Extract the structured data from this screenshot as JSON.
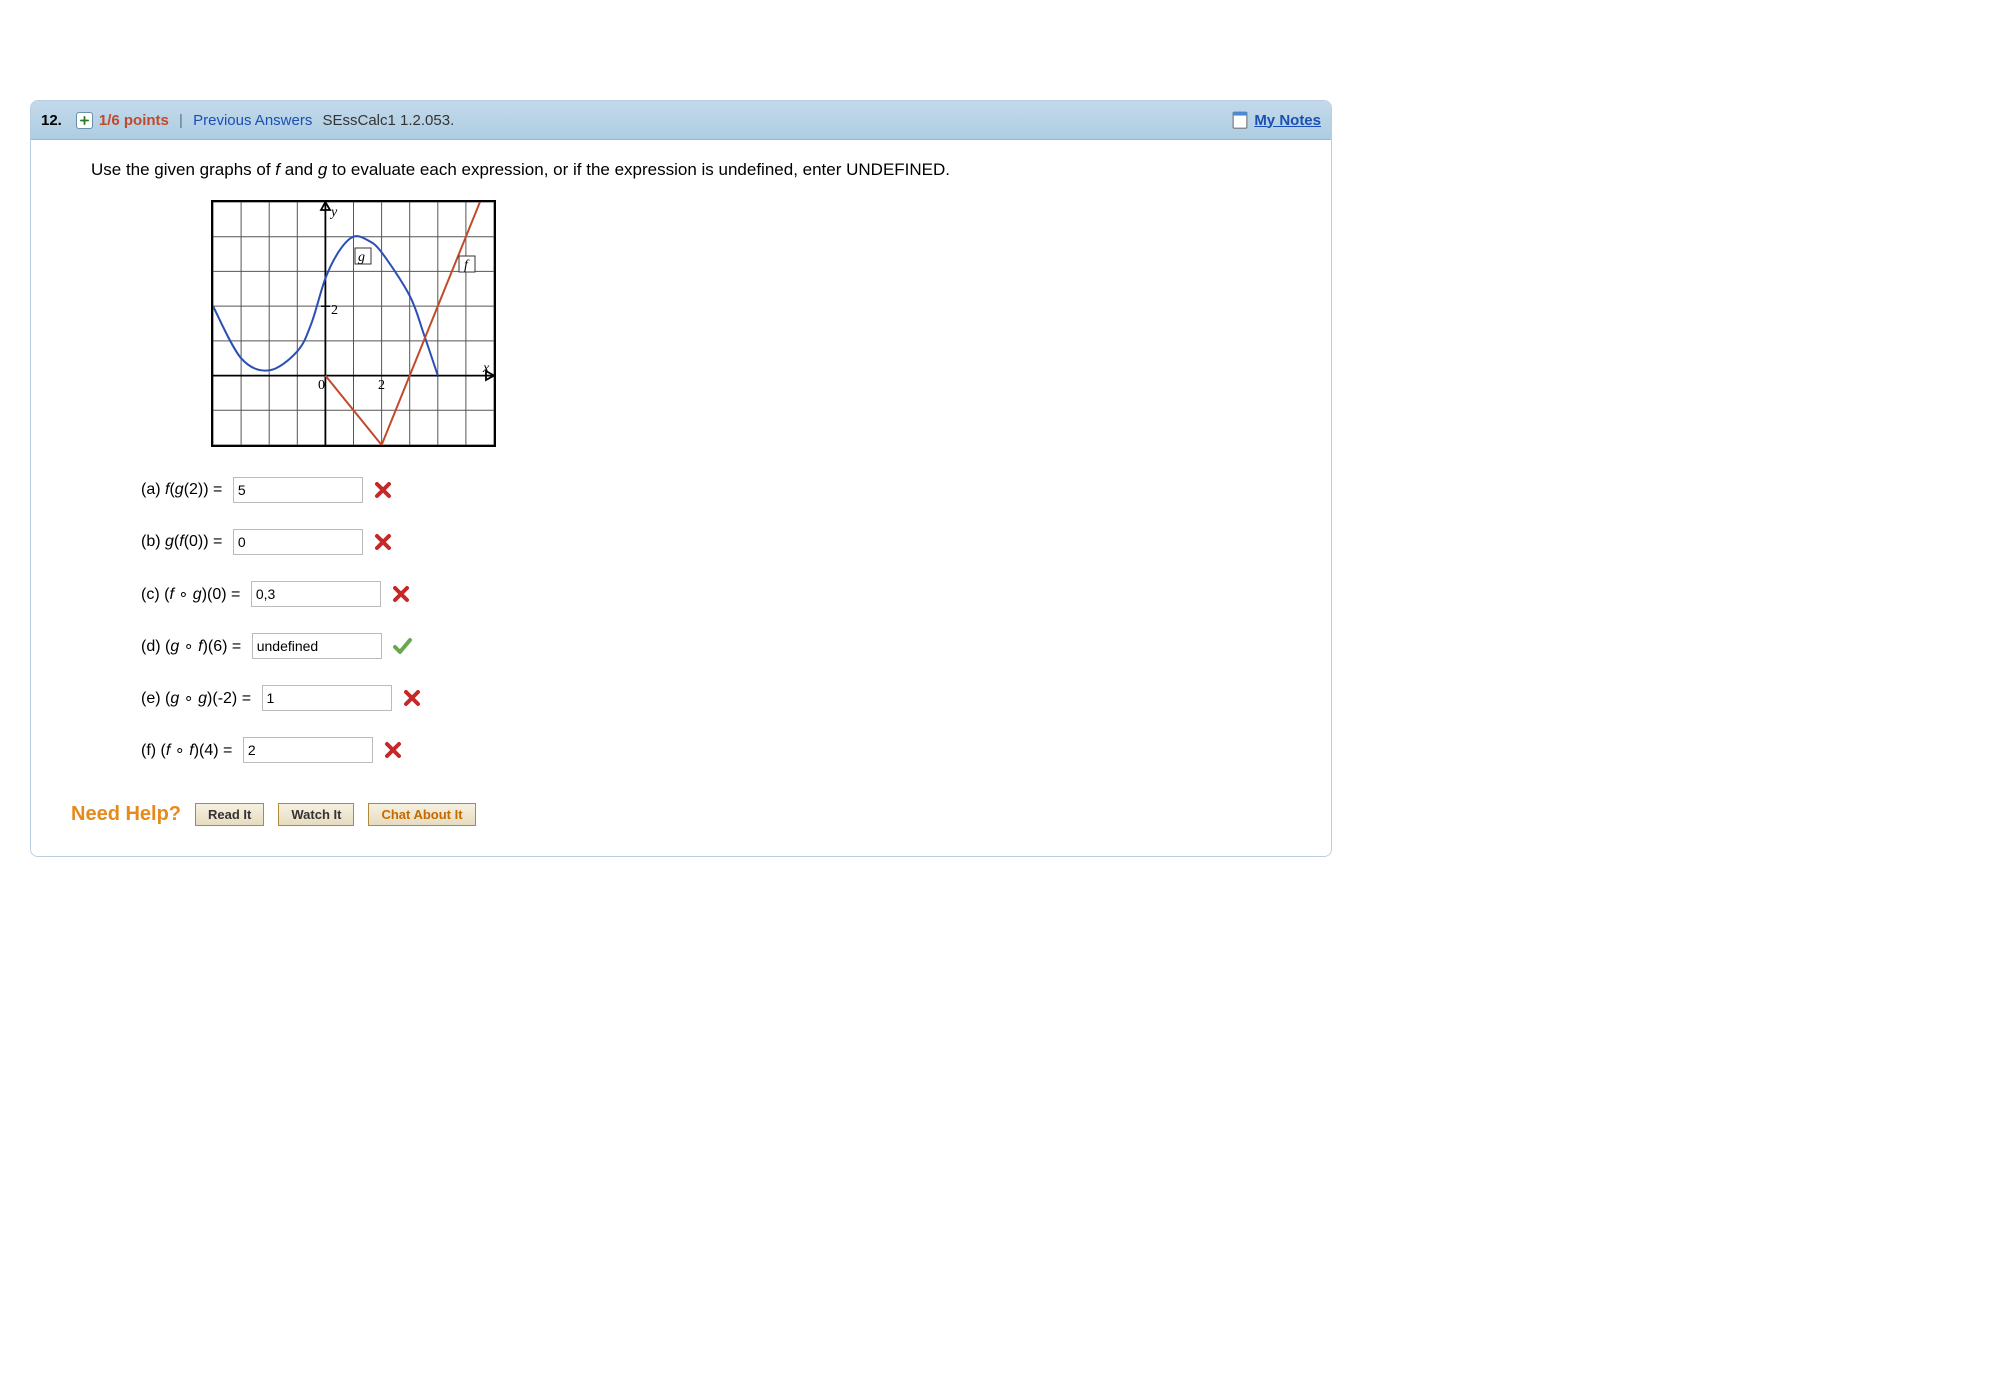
{
  "header": {
    "number": "12.",
    "points": "1/6 points",
    "prev_answers": "Previous Answers",
    "code": "SEssCalc1 1.2.053.",
    "my_notes": "My Notes"
  },
  "instruction": "Use the given graphs of f and g to evaluate each expression, or if the expression is undefined, enter UNDEFINED.",
  "graph": {
    "y_label": "y",
    "x_label": "x",
    "origin_label": "0",
    "x_tick": "2",
    "y_tick": "2",
    "f_label": "f",
    "g_label": "g"
  },
  "parts": {
    "a": {
      "label_pre": "(a) ",
      "expr_html": "f(g(2)) = ",
      "value": "5",
      "correct": false
    },
    "b": {
      "label_pre": "(b) ",
      "expr_html": "g(f(0)) = ",
      "value": "0",
      "correct": false
    },
    "c": {
      "label_pre": "(c) ",
      "expr_html": "(f ∘ g)(0) = ",
      "value": "0,3",
      "correct": false
    },
    "d": {
      "label_pre": "(d) ",
      "expr_html": "(g ∘ f)(6) = ",
      "value": "undefined",
      "correct": true
    },
    "e": {
      "label_pre": "(e) ",
      "expr_html": "(g ∘ g)(-2) = ",
      "value": "1",
      "correct": false
    },
    "f": {
      "label_pre": "(f) ",
      "expr_html": "(f ∘ f)(4) = ",
      "value": "2",
      "correct": false
    }
  },
  "help": {
    "label": "Need Help?",
    "read": "Read It",
    "watch": "Watch It",
    "chat": "Chat About It"
  },
  "chart_data": {
    "type": "line",
    "title": "",
    "xlabel": "x",
    "ylabel": "y",
    "xlim": [
      -4,
      6
    ],
    "ylim": [
      -2,
      5
    ],
    "x_ticks_labeled": [
      0,
      2
    ],
    "y_ticks_labeled": [
      0,
      2
    ],
    "grid": true,
    "series": [
      {
        "name": "g",
        "label_pos": [
          1.3,
          3.4
        ],
        "points": [
          {
            "x": -4,
            "y": 2.0
          },
          {
            "x": -3,
            "y": 0.5
          },
          {
            "x": -2,
            "y": 0.15
          },
          {
            "x": -1,
            "y": 0.7
          },
          {
            "x": -0.5,
            "y": 1.5
          },
          {
            "x": 0,
            "y": 2.8
          },
          {
            "x": 0.5,
            "y": 3.6
          },
          {
            "x": 1,
            "y": 4.0
          },
          {
            "x": 1.5,
            "y": 3.9
          },
          {
            "x": 2,
            "y": 3.55
          },
          {
            "x": 3,
            "y": 2.3
          },
          {
            "x": 3.5,
            "y": 1.2
          },
          {
            "x": 4,
            "y": 0.0
          }
        ]
      },
      {
        "name": "f",
        "label_pos": [
          5.0,
          3.2
        ],
        "points": [
          {
            "x": 0,
            "y": 0.0
          },
          {
            "x": 1,
            "y": -1.0
          },
          {
            "x": 2,
            "y": -2.0
          },
          {
            "x": 3,
            "y": 0.0
          },
          {
            "x": 4,
            "y": 2.0
          },
          {
            "x": 5,
            "y": 4.0
          },
          {
            "x": 5.5,
            "y": 5.0
          }
        ]
      }
    ]
  }
}
